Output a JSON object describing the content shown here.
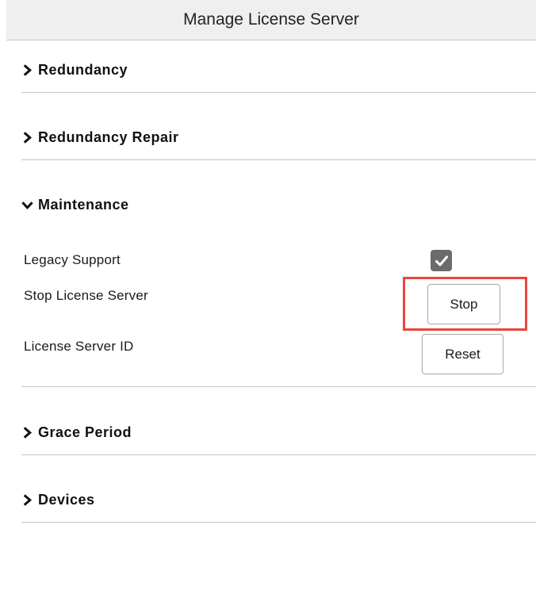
{
  "header": {
    "title": "Manage License Server"
  },
  "sections": [
    {
      "label": "Redundancy",
      "expanded": false,
      "icon": "chevron-right-icon"
    },
    {
      "label": "Redundancy Repair",
      "expanded": false,
      "icon": "chevron-right-icon"
    },
    {
      "label": "Maintenance",
      "expanded": true,
      "icon": "chevron-down-icon"
    },
    {
      "label": "Grace Period",
      "expanded": false,
      "icon": "chevron-right-icon"
    },
    {
      "label": "Devices",
      "expanded": false,
      "icon": "chevron-right-icon"
    }
  ],
  "maintenance": {
    "legacy_support": {
      "label": "Legacy Support",
      "checked": true
    },
    "stop_server": {
      "label": "Stop License Server",
      "button": "Stop"
    },
    "server_id": {
      "label": "License Server ID",
      "button": "Reset"
    }
  },
  "colors": {
    "header_bg": "#efefef",
    "divider": "#c6c6c6",
    "checkbox_fill": "#6b6b6b",
    "highlight": "#e8453c"
  }
}
